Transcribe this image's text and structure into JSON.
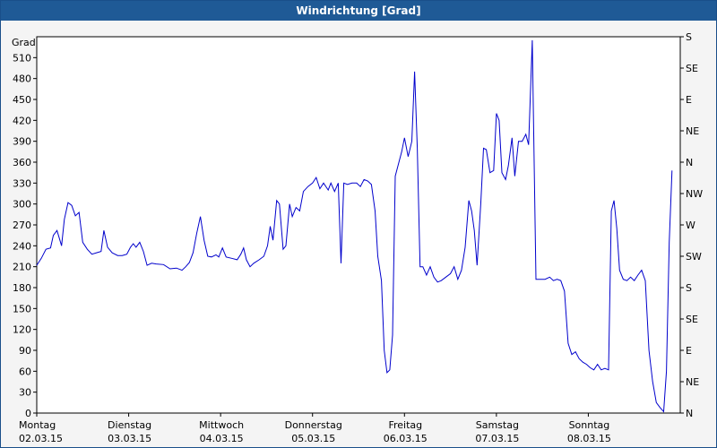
{
  "window": {
    "title": "Windrichtung [Grad]"
  },
  "chart_data": {
    "type": "line",
    "title": "Windrichtung [Grad]",
    "ylabel": "Grad",
    "ylim": [
      0,
      540
    ],
    "yticks": [
      0,
      30,
      60,
      90,
      120,
      150,
      180,
      210,
      240,
      270,
      300,
      330,
      360,
      390,
      420,
      450,
      480,
      510
    ],
    "right_axis_labels": [
      "N",
      "NE",
      "E",
      "SE",
      "S",
      "SW",
      "W",
      "NW",
      "N",
      "NE",
      "E",
      "SE",
      "S"
    ],
    "right_axis_values": [
      0,
      45,
      90,
      135,
      180,
      225,
      270,
      315,
      360,
      405,
      450,
      495,
      540
    ],
    "x_days": [
      {
        "day": "Montag",
        "date": "02.03.15"
      },
      {
        "day": "Dienstag",
        "date": "03.03.15"
      },
      {
        "day": "Mittwoch",
        "date": "04.03.15"
      },
      {
        "day": "Donnerstag",
        "date": "05.03.15"
      },
      {
        "day": "Freitag",
        "date": "06.03.15"
      },
      {
        "day": "Samstag",
        "date": "07.03.15"
      },
      {
        "day": "Sonntag",
        "date": "08.03.15"
      }
    ],
    "xlim": [
      0,
      7
    ],
    "grid": true,
    "series": [
      {
        "color": "#0000cc",
        "points": [
          [
            0.0,
            212
          ],
          [
            0.05,
            222
          ],
          [
            0.1,
            235
          ],
          [
            0.15,
            237
          ],
          [
            0.18,
            255
          ],
          [
            0.22,
            262
          ],
          [
            0.27,
            240
          ],
          [
            0.3,
            278
          ],
          [
            0.34,
            302
          ],
          [
            0.38,
            298
          ],
          [
            0.42,
            283
          ],
          [
            0.46,
            288
          ],
          [
            0.5,
            245
          ],
          [
            0.55,
            235
          ],
          [
            0.6,
            228
          ],
          [
            0.65,
            230
          ],
          [
            0.7,
            232
          ],
          [
            0.73,
            262
          ],
          [
            0.77,
            238
          ],
          [
            0.82,
            230
          ],
          [
            0.88,
            226
          ],
          [
            0.93,
            226
          ],
          [
            0.98,
            228
          ],
          [
            1.02,
            238
          ],
          [
            1.05,
            243
          ],
          [
            1.08,
            238
          ],
          [
            1.12,
            245
          ],
          [
            1.16,
            232
          ],
          [
            1.2,
            212
          ],
          [
            1.25,
            215
          ],
          [
            1.3,
            214
          ],
          [
            1.38,
            213
          ],
          [
            1.45,
            207
          ],
          [
            1.52,
            208
          ],
          [
            1.58,
            205
          ],
          [
            1.62,
            210
          ],
          [
            1.66,
            216
          ],
          [
            1.7,
            230
          ],
          [
            1.74,
            258
          ],
          [
            1.78,
            282
          ],
          [
            1.82,
            248
          ],
          [
            1.86,
            225
          ],
          [
            1.9,
            224
          ],
          [
            1.95,
            227
          ],
          [
            1.98,
            224
          ],
          [
            2.02,
            237
          ],
          [
            2.06,
            224
          ],
          [
            2.12,
            222
          ],
          [
            2.18,
            220
          ],
          [
            2.22,
            228
          ],
          [
            2.25,
            237
          ],
          [
            2.28,
            220
          ],
          [
            2.32,
            210
          ],
          [
            2.36,
            215
          ],
          [
            2.42,
            220
          ],
          [
            2.47,
            225
          ],
          [
            2.51,
            240
          ],
          [
            2.54,
            268
          ],
          [
            2.57,
            248
          ],
          [
            2.61,
            305
          ],
          [
            2.64,
            300
          ],
          [
            2.68,
            235
          ],
          [
            2.71,
            240
          ],
          [
            2.75,
            300
          ],
          [
            2.78,
            282
          ],
          [
            2.82,
            295
          ],
          [
            2.86,
            290
          ],
          [
            2.9,
            318
          ],
          [
            2.95,
            325
          ],
          [
            3.0,
            330
          ],
          [
            3.04,
            338
          ],
          [
            3.08,
            322
          ],
          [
            3.12,
            330
          ],
          [
            3.17,
            320
          ],
          [
            3.2,
            330
          ],
          [
            3.24,
            318
          ],
          [
            3.28,
            330
          ],
          [
            3.31,
            215
          ],
          [
            3.34,
            330
          ],
          [
            3.38,
            328
          ],
          [
            3.43,
            330
          ],
          [
            3.48,
            330
          ],
          [
            3.52,
            325
          ],
          [
            3.56,
            335
          ],
          [
            3.6,
            333
          ],
          [
            3.64,
            328
          ],
          [
            3.68,
            290
          ],
          [
            3.71,
            225
          ],
          [
            3.75,
            190
          ],
          [
            3.78,
            90
          ],
          [
            3.81,
            58
          ],
          [
            3.84,
            62
          ],
          [
            3.87,
            112
          ],
          [
            3.9,
            340
          ],
          [
            3.94,
            360
          ],
          [
            3.97,
            375
          ],
          [
            4.0,
            395
          ],
          [
            4.04,
            368
          ],
          [
            4.08,
            390
          ],
          [
            4.11,
            490
          ],
          [
            4.14,
            380
          ],
          [
            4.17,
            210
          ],
          [
            4.2,
            210
          ],
          [
            4.24,
            198
          ],
          [
            4.28,
            210
          ],
          [
            4.32,
            195
          ],
          [
            4.36,
            188
          ],
          [
            4.4,
            190
          ],
          [
            4.45,
            195
          ],
          [
            4.5,
            200
          ],
          [
            4.54,
            210
          ],
          [
            4.58,
            192
          ],
          [
            4.62,
            205
          ],
          [
            4.66,
            238
          ],
          [
            4.7,
            305
          ],
          [
            4.73,
            290
          ],
          [
            4.76,
            262
          ],
          [
            4.79,
            212
          ],
          [
            4.83,
            300
          ],
          [
            4.86,
            380
          ],
          [
            4.89,
            378
          ],
          [
            4.93,
            345
          ],
          [
            4.97,
            348
          ],
          [
            5.0,
            430
          ],
          [
            5.03,
            420
          ],
          [
            5.06,
            345
          ],
          [
            5.1,
            335
          ],
          [
            5.13,
            355
          ],
          [
            5.17,
            395
          ],
          [
            5.2,
            340
          ],
          [
            5.24,
            390
          ],
          [
            5.28,
            390
          ],
          [
            5.32,
            400
          ],
          [
            5.35,
            385
          ],
          [
            5.39,
            535
          ],
          [
            5.43,
            192
          ],
          [
            5.48,
            192
          ],
          [
            5.53,
            192
          ],
          [
            5.58,
            195
          ],
          [
            5.62,
            190
          ],
          [
            5.66,
            192
          ],
          [
            5.7,
            190
          ],
          [
            5.74,
            175
          ],
          [
            5.78,
            100
          ],
          [
            5.82,
            84
          ],
          [
            5.86,
            88
          ],
          [
            5.9,
            78
          ],
          [
            5.94,
            73
          ],
          [
            5.98,
            70
          ],
          [
            6.02,
            65
          ],
          [
            6.06,
            62
          ],
          [
            6.1,
            70
          ],
          [
            6.14,
            62
          ],
          [
            6.18,
            64
          ],
          [
            6.22,
            62
          ],
          [
            6.25,
            290
          ],
          [
            6.28,
            305
          ],
          [
            6.31,
            265
          ],
          [
            6.34,
            205
          ],
          [
            6.38,
            192
          ],
          [
            6.42,
            190
          ],
          [
            6.46,
            195
          ],
          [
            6.5,
            190
          ],
          [
            6.54,
            198
          ],
          [
            6.58,
            205
          ],
          [
            6.62,
            190
          ],
          [
            6.66,
            90
          ],
          [
            6.7,
            45
          ],
          [
            6.74,
            15
          ],
          [
            6.78,
            8
          ],
          [
            6.82,
            2
          ],
          [
            6.85,
            60
          ],
          [
            6.88,
            245
          ],
          [
            6.91,
            348
          ]
        ]
      }
    ]
  }
}
